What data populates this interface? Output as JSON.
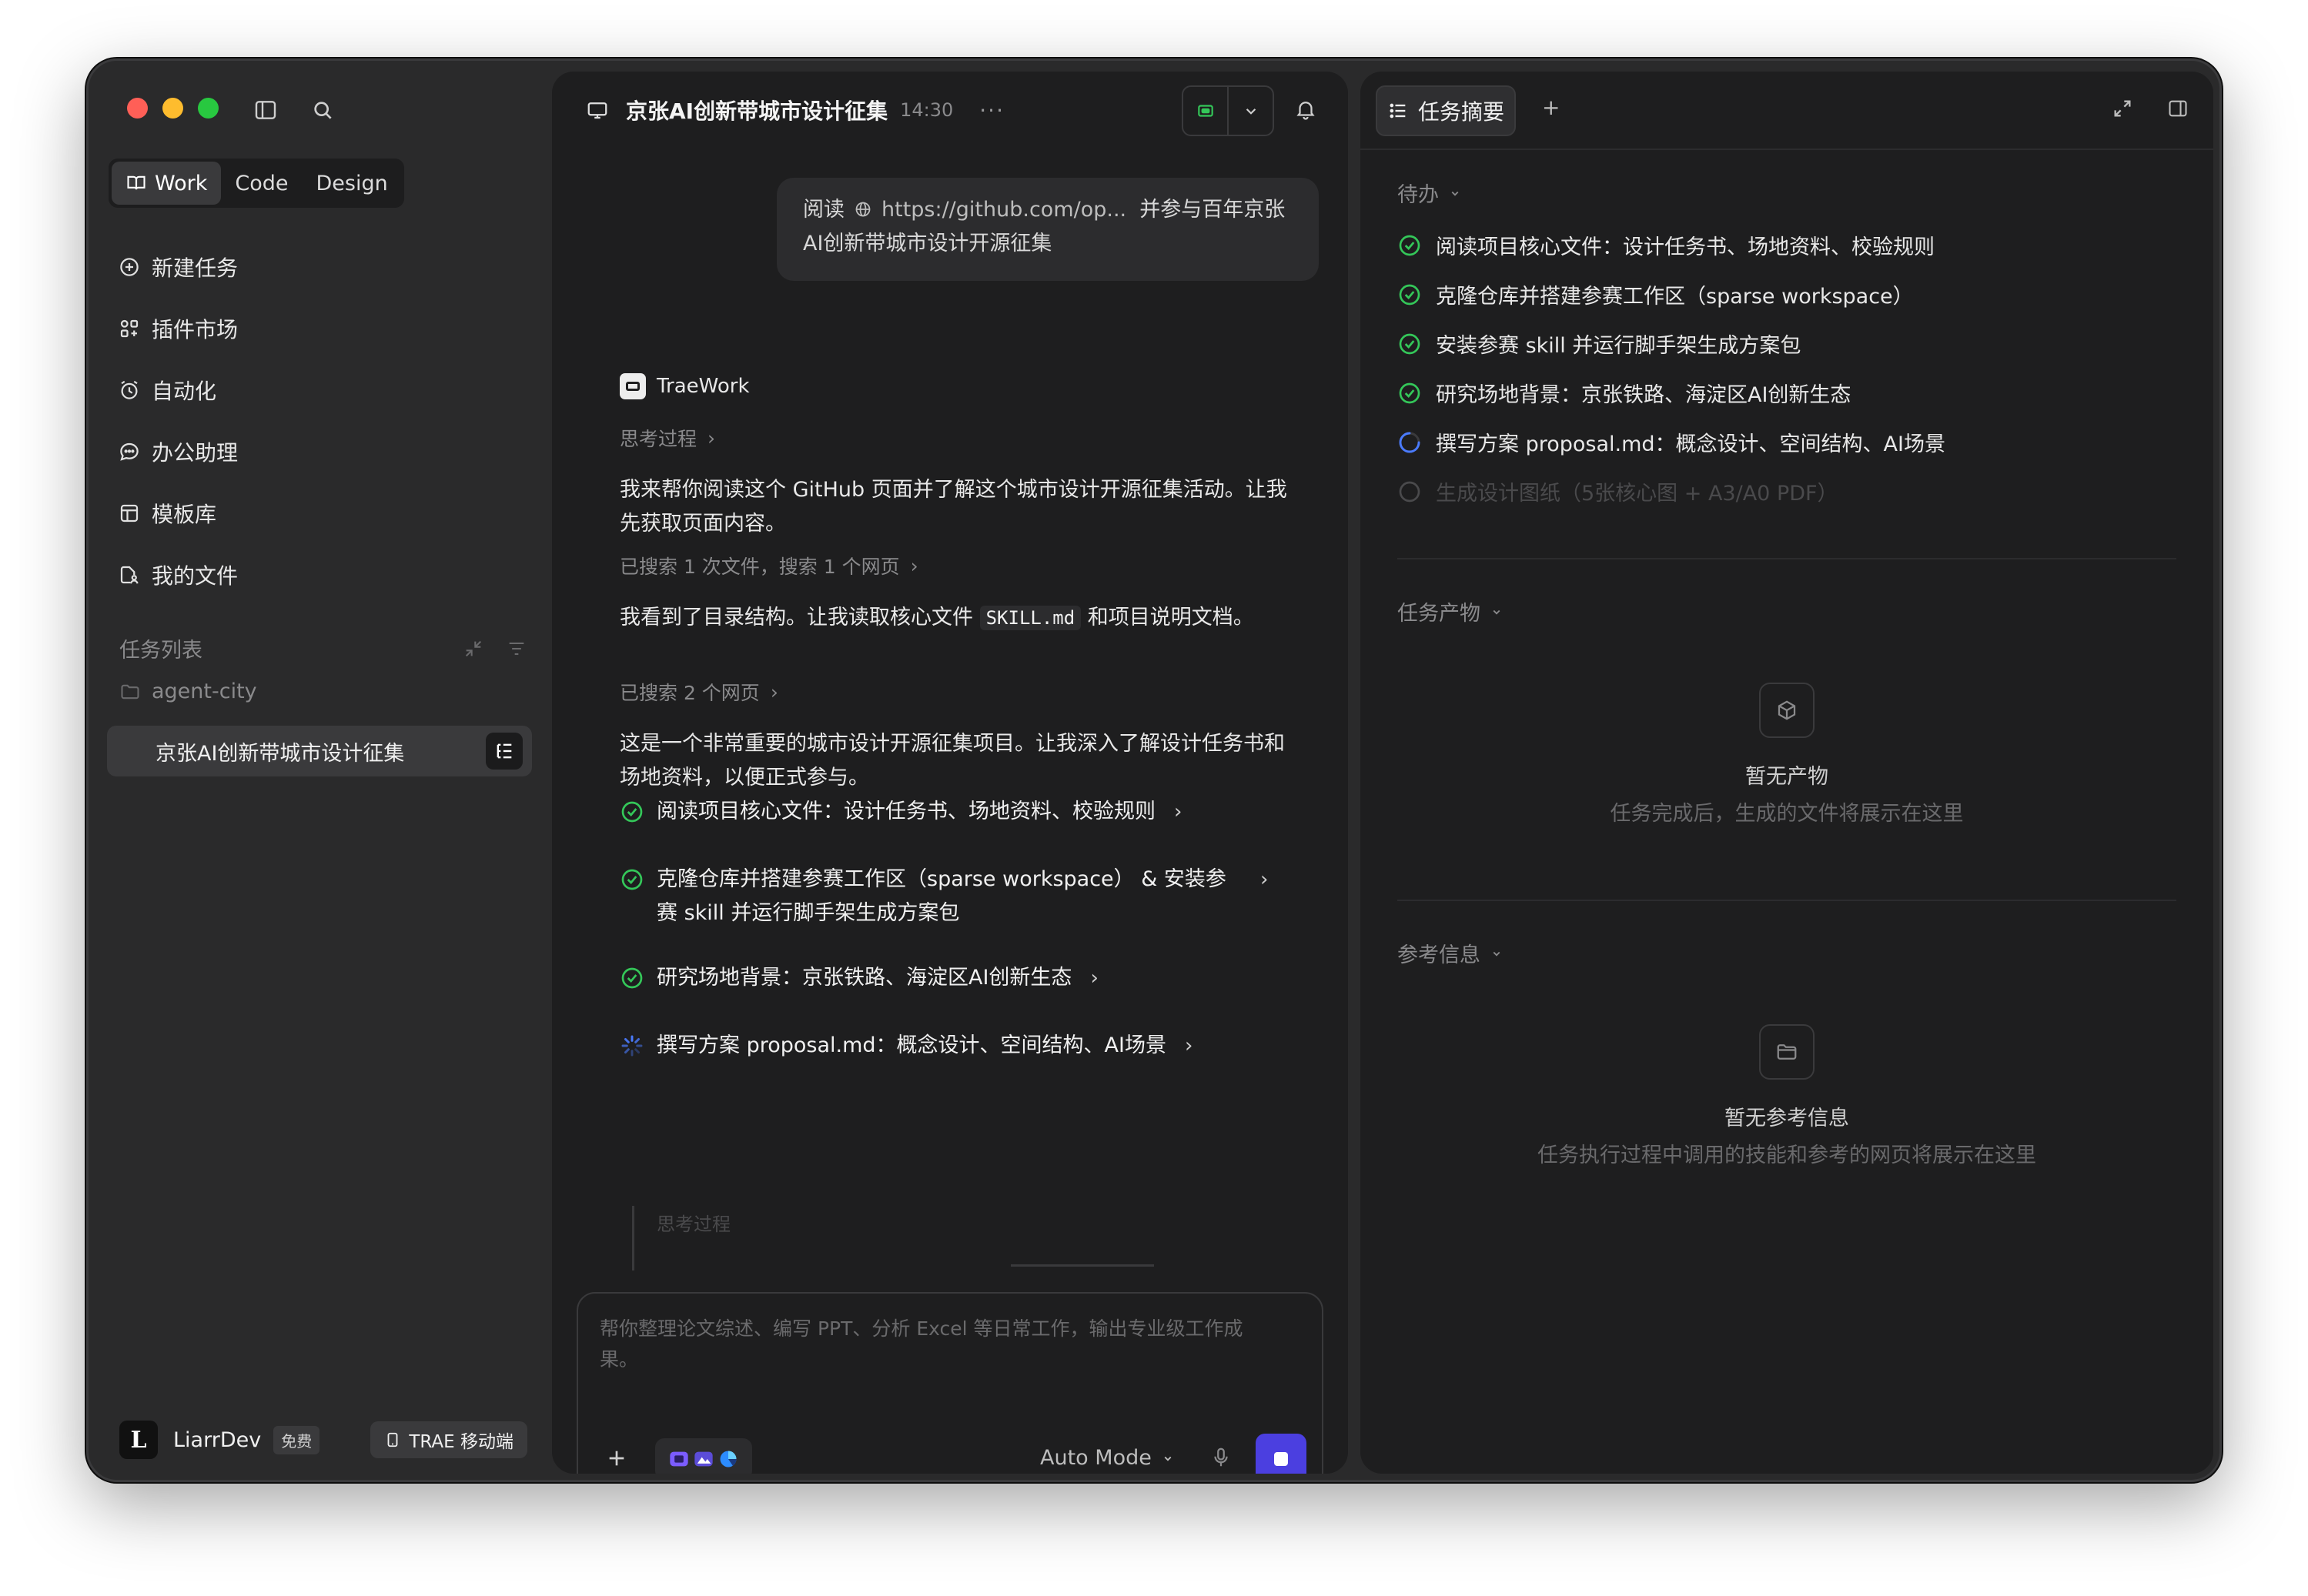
{
  "sidebar": {
    "segments": [
      "Work",
      "Code",
      "Design"
    ],
    "active_segment": "Work",
    "nav": [
      {
        "label": "新建任务",
        "icon": "plus-circle-icon"
      },
      {
        "label": "插件市场",
        "icon": "plugin-grid-icon"
      },
      {
        "label": "自动化",
        "icon": "alarm-clock-icon"
      },
      {
        "label": "办公助理",
        "icon": "chat-bubble-icon"
      },
      {
        "label": "模板库",
        "icon": "template-icon"
      },
      {
        "label": "我的文件",
        "icon": "file-user-icon"
      }
    ],
    "task_list_title": "任务列表",
    "folder": "agent-city",
    "current_task": "京张AI创新带城市设计征集",
    "user": {
      "name": "LiarrDev",
      "plan": "免费",
      "avatar_letter": "L"
    },
    "mobile_label": "TRAE 移动端"
  },
  "conversation": {
    "title": "京张AI创新带城市设计征集",
    "time": "14:30",
    "more": "···",
    "user_message": {
      "prefix": "阅读",
      "link": "https://github.com/op...",
      "rest": "并参与百年京张",
      "line2": "AI创新带城市设计开源征集"
    },
    "agent_name": "TraeWork",
    "thinking_label": "思考过程",
    "para1": "我来帮你阅读这个 GitHub 页面并了解这个城市设计开源征集活动。让我先获取页面内容。",
    "search1": "已搜索 1 次文件，搜索 1 个网页",
    "para2_before": "我看到了目录结构。让我读取核心文件",
    "para2_code": "SKILL.md",
    "para2_after": "和项目说明文档。",
    "search2": "已搜索 2 个网页",
    "para3": "这是一个非常重要的城市设计开源征集项目。让我深入了解设计任务书和场地资料，以便正式参与。",
    "steps": [
      {
        "label": "阅读项目核心文件：设计任务书、场地资料、校验规则",
        "status": "done"
      },
      {
        "label": "克隆仓库并搭建参赛工作区（sparse workspace） & 安装参赛 skill 并运行脚手架生成方案包",
        "status": "done"
      },
      {
        "label": "研究场地背景：京张铁路、海淀区AI创新生态",
        "status": "done"
      },
      {
        "label": "撰写方案 proposal.md：概念设计、空间结构、AI场景",
        "status": "running"
      }
    ],
    "faded_thinking": "思考过程",
    "composer_placeholder": "帮你整理论文综述、编写 PPT、分析 Excel 等日常工作，输出专业级工作成果。",
    "mode": "Auto Mode"
  },
  "summary": {
    "tab_label": "任务摘要",
    "add_label": "+",
    "todo_title": "待办",
    "todos": [
      {
        "label": "阅读项目核心文件：设计任务书、场地资料、校验规则",
        "status": "done"
      },
      {
        "label": "克隆仓库并搭建参赛工作区（sparse workspace）",
        "status": "done"
      },
      {
        "label": "安装参赛 skill 并运行脚手架生成方案包",
        "status": "done"
      },
      {
        "label": "研究场地背景：京张铁路、海淀区AI创新生态",
        "status": "done"
      },
      {
        "label": "撰写方案 proposal.md：概念设计、空间结构、AI场景",
        "status": "running"
      },
      {
        "label": "生成设计图纸（5张核心图 + A3/A0 PDF）",
        "status": "pending"
      }
    ],
    "artifacts_title": "任务产物",
    "artifacts_empty_title": "暂无产物",
    "artifacts_empty_sub": "任务完成后，生成的文件将展示在这里",
    "refs_title": "参考信息",
    "refs_empty_title": "暂无参考信息",
    "refs_empty_sub": "任务执行过程中调用的技能和参考的网页将展示在这里"
  },
  "colors": {
    "accent": "#4b3fe0",
    "success": "#34c759",
    "running": "#4a7bff"
  }
}
